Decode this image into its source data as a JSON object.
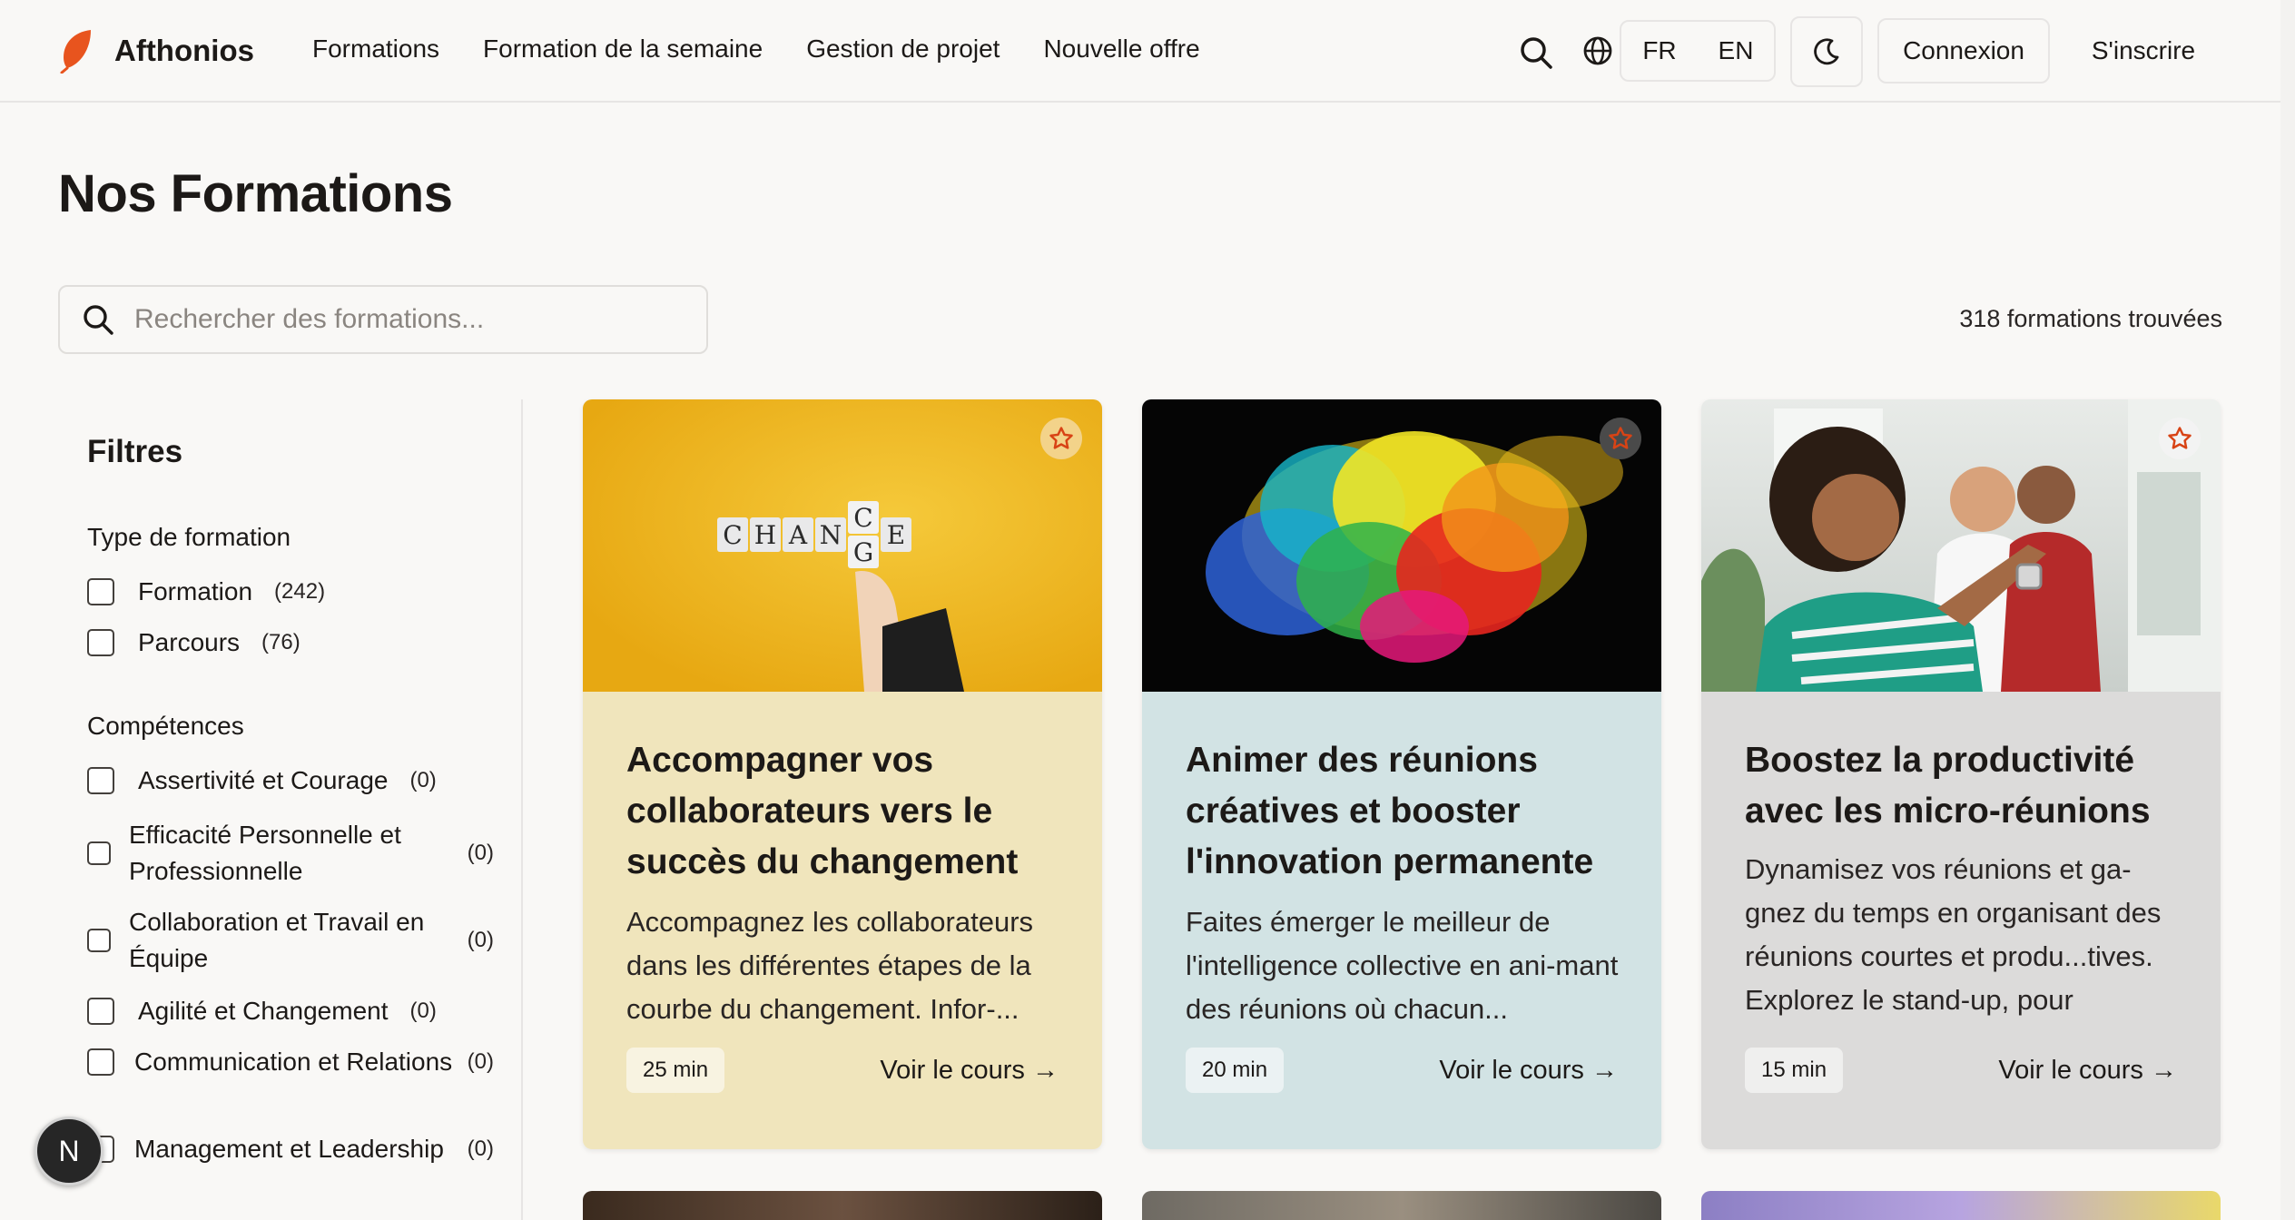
{
  "header": {
    "brand": "Afthonios",
    "nav": [
      "Formations",
      "Formation de la semaine",
      "Gestion de projet",
      "Nouvelle offre"
    ],
    "lang_fr": "FR",
    "lang_en": "EN",
    "login": "Connexion",
    "signup": "S'inscrire"
  },
  "main": {
    "title": "Nos Formations",
    "search_placeholder": "Rechercher des formations...",
    "result_count": "318 formations trouvées"
  },
  "filters": {
    "title": "Filtres",
    "type_title": "Type de formation",
    "types": [
      {
        "label": "Formation",
        "count": "(242)"
      },
      {
        "label": "Parcours",
        "count": "(76)"
      }
    ],
    "skills_title": "Compétences",
    "skills": [
      {
        "label": "Assertivité et Courage",
        "count": "(0)"
      },
      {
        "label": "Efficacité Personnelle et Professionnelle",
        "count": "(0)"
      },
      {
        "label": "Collaboration et Travail en Équipe",
        "count": "(0)"
      },
      {
        "label": "Agilité et Changement",
        "count": "(0)"
      },
      {
        "label": "Communication et Relations",
        "count": "(0)"
      },
      {
        "label": "Management et Leadership",
        "count": "(0)"
      }
    ]
  },
  "cards": [
    {
      "title": "Accompagner vos collaborateurs vers le succès du changement",
      "desc": "Accompagnez les collaborateurs dans les différentes étapes de la courbe du changement. Infor-...",
      "duration": "25 min",
      "link": "Voir le cours →",
      "image_letters": [
        "C",
        "H",
        "A",
        "N",
        "E"
      ],
      "image_letters_alt": [
        "C",
        "G"
      ],
      "bg": "#f0e5bc"
    },
    {
      "title": "Animer des réunions créatives et booster l'innovation permanente",
      "desc": "Faites émerger le meilleur de l'intelligence collective en ani-mant des réunions où chacun...",
      "duration": "20 min",
      "link": "Voir le cours →",
      "bg": "#d2e3e4"
    },
    {
      "title": "Boostez la productivité avec les micro-réunions",
      "desc": "Dynamisez vos réunions et ga-gnez du temps en organisant des réunions courtes et produ...tives. Explorez le stand-up, pour",
      "duration": "15 min",
      "link": "Voir le cours →",
      "bg": "#dcdbda"
    }
  ],
  "fab": "N",
  "colors": {
    "brand_leaf": "#e8541e",
    "star": "#d84315",
    "background": "#f9f8f6"
  }
}
